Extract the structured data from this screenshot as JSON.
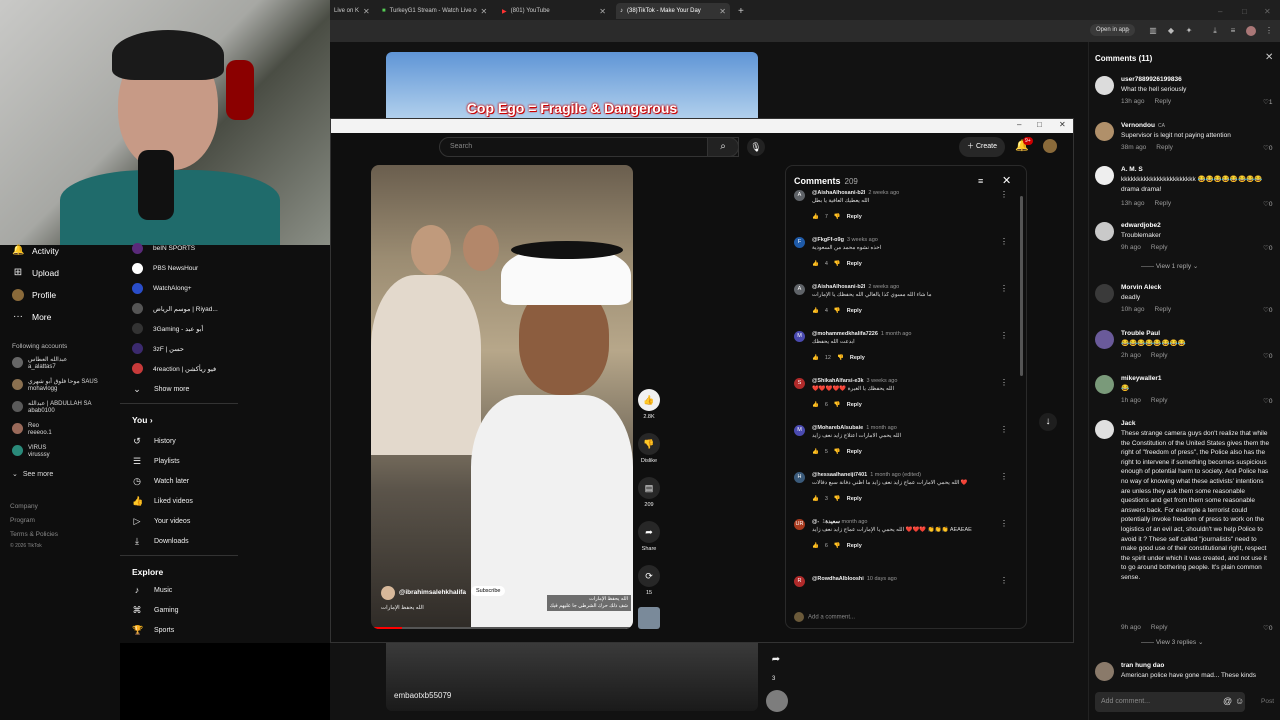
{
  "browser": {
    "tabs": [
      {
        "label": "Live on K"
      },
      {
        "label": "TurkeyG1 Stream - Watch Live o"
      },
      {
        "label": "(801) YouTube"
      },
      {
        "label": "(38)TikTok - Make Your Day"
      }
    ],
    "open_in_app": "Open in app"
  },
  "tiktok_left": {
    "nav": [
      {
        "label": "Activity",
        "icon": "bell-icon"
      },
      {
        "label": "Upload",
        "icon": "upload-icon"
      },
      {
        "label": "Profile",
        "icon": "profile-icon"
      },
      {
        "label": "More",
        "icon": "more-icon"
      }
    ],
    "following_header": "Following accounts",
    "accounts": [
      {
        "name": "عبدالله العطاس",
        "handle": "a_alattas7"
      },
      {
        "name": "موحا فلوق أبو شهري SAUS",
        "handle": "mohavlogg"
      },
      {
        "name": "عبدالله | ABDULLAH SA",
        "handle": "abab0100"
      },
      {
        "name": "Reo",
        "handle": "reeeoo.1"
      },
      {
        "name": "VIRUS",
        "handle": "virusssy"
      }
    ],
    "see_more": "See more",
    "footer": [
      "Company",
      "Program",
      "Terms & Policies",
      "© 2026 TikTok"
    ]
  },
  "youtube_left": {
    "subscriptions": [
      {
        "label": "beIN SPORTS",
        "color": "#5a2a7a"
      },
      {
        "label": "PBS NewsHour",
        "color": "#ffffff"
      },
      {
        "label": "WatchAlong+",
        "color": "#2a4dc9"
      },
      {
        "label": "موسم الرياض | Riyad...",
        "color": "#555555"
      },
      {
        "label": "3Gaming - أبو عبد",
        "color": "#333333"
      },
      {
        "label": "3zF | حسن",
        "color": "#3b2a6e"
      },
      {
        "label": "4reaction | فيو ريأكشن",
        "color": "#c73a3a"
      }
    ],
    "show_more": "Show more",
    "you_section": "You",
    "you_items": [
      "History",
      "Playlists",
      "Watch later",
      "Liked videos",
      "Your videos",
      "Downloads"
    ],
    "explore_section": "Explore",
    "explore_items": [
      "Music",
      "Gaming",
      "Sports"
    ]
  },
  "video_top_caption": "Cop Ego = Fragile & Dangerous",
  "youtube": {
    "search_placeholder": "Search",
    "create_label": "Create",
    "notif_badge": "9+",
    "short": {
      "channel": "@ibrahimsalehkhalifa",
      "subscribe": "Subscribe",
      "description": "الله يحفظ الإمارات",
      "overlay_line1": "الله يحفظ الإمارات",
      "overlay_line2": "شف ذلك حرك الشرطي جا عليهم فيك",
      "progress_pct": 12
    },
    "actions": {
      "likes": "2.8K",
      "dislike": "Dislike",
      "comments": "209",
      "share": "Share",
      "remix": "15"
    },
    "comments_title": "Comments",
    "comments_count": "209",
    "comments": [
      {
        "user": "@AishaAlhosani-b2l",
        "time": "2 weeks ago",
        "text": "الله يعطيك العافية يا بطل",
        "likes": "7",
        "avatar": "A",
        "color": "#5f6368"
      },
      {
        "user": "@FkgFf-o9g",
        "time": "3 weeks ago",
        "text": "اخذه نشوه محمد من السعودية",
        "likes": "4",
        "avatar": "F",
        "color": "#1e5aa8"
      },
      {
        "user": "@AishaAlhosani-b2l",
        "time": "2 weeks ago",
        "text": "ما شاء الله مسوي كذا يالغالي الله يحفظك يا الإمارات",
        "likes": "4",
        "avatar": "A",
        "color": "#5f6368"
      },
      {
        "user": "@mohammedkhalifa7226",
        "time": "1 month ago",
        "text": "ابدعت الله يحفظك",
        "likes": "12",
        "avatar": "M",
        "color": "#4a4ab0"
      },
      {
        "user": "@ShikahAlfarsi-e3k",
        "time": "3 weeks ago",
        "text": "❤️❤️❤️❤️❤️ الله يحفظك يا الغيرة",
        "likes": "6",
        "avatar": "S",
        "color": "#b02a2a"
      },
      {
        "user": "@MoharebAlsubaie",
        "time": "1 month ago",
        "text": "الله يحمي الامارات اعتلاج زايد نعف زايد",
        "likes": "5",
        "avatar": "M",
        "color": "#4a4ab0"
      },
      {
        "user": "@hessaalhaneiji7401",
        "time": "1 month ago (edited)",
        "text": "الله يحمي الامارات عماج زايد نعف زايد ما اظني دفانة سبع دفالات ❤️",
        "likes": "3",
        "avatar": "H",
        "color": "#3a5a7a"
      },
      {
        "user": "@-سعيدة",
        "time": "1 month ago",
        "text": "الله يحمي يا الإمارات عماج زايد نعف زايد ❤️❤️❤️ 👏👏👏 AEAEAE",
        "likes": "6",
        "avatar": "UR",
        "color": "#a83a1e"
      },
      {
        "user": "@RowdhaAlblooshi",
        "time": "10 days ago",
        "text": "",
        "likes": "",
        "avatar": "R",
        "color": "#b02a2a"
      }
    ],
    "reply": "Reply",
    "add_comment": "Add a comment..."
  },
  "next_video_user": "embaotxb55079",
  "next_share_count": "3",
  "tiktok_comments": {
    "title": "Comments (11)",
    "items": [
      {
        "user": "user7889926199836",
        "tag": "",
        "text": "What the hell seriously",
        "time": "13h ago",
        "likes": "1"
      },
      {
        "user": "Vernondou",
        "tag": "CA",
        "text": "Supervisor is legit not paying attention",
        "time": "38m ago",
        "likes": "0"
      },
      {
        "user": "A. M. S",
        "tag": "",
        "text": "kkkkkkkkkkkkkkkkkkkkkkk 😂😂😂😂😂😂😂😂 drama drama!",
        "time": "13h ago",
        "likes": "0"
      },
      {
        "user": "edwardjobe2",
        "tag": "",
        "text": "Troublemaker",
        "time": "9h ago",
        "likes": "0",
        "view_replies": "View 1 reply"
      },
      {
        "user": "Morvin Aleck",
        "tag": "",
        "text": "deadly",
        "time": "10h ago",
        "likes": "0"
      },
      {
        "user": "Trouble Paul",
        "tag": "",
        "text": "😂😂😂😂😂😂😂😂",
        "time": "2h ago",
        "likes": "0"
      },
      {
        "user": "mikeywaller1",
        "tag": "",
        "text": "😂",
        "time": "1h ago",
        "likes": "0"
      },
      {
        "user": "Jack",
        "tag": "",
        "text": "These strange camera guys don't realize that while the Constitution of the United States gives them the right of \"freedom of press\", the Police also has the right to intervene if something becomes suspicious enough of potential harm to society. And Police has no way of knowing what these activists' intentions are unless they ask them some reasonable questions and get from them some reasonable answers back. For example a terrorist could potentially invoke freedom of press to work on the logistics of an evil act, shouldn't we help Police to avoid it ? These self called \"journalists\" need to make good use of their constitutional right, respect the spirit under which it was created, and not use it to go around bothering people. It's plain common sense.",
        "time": "9h ago",
        "likes": "0",
        "view_replies": "View 3 replies"
      },
      {
        "user": "tran hung dao",
        "tag": "",
        "text": "American police have gone mad... These kinds",
        "time": "",
        "likes": ""
      }
    ],
    "reply": "Reply",
    "add_placeholder": "Add comment...",
    "post": "Post"
  }
}
